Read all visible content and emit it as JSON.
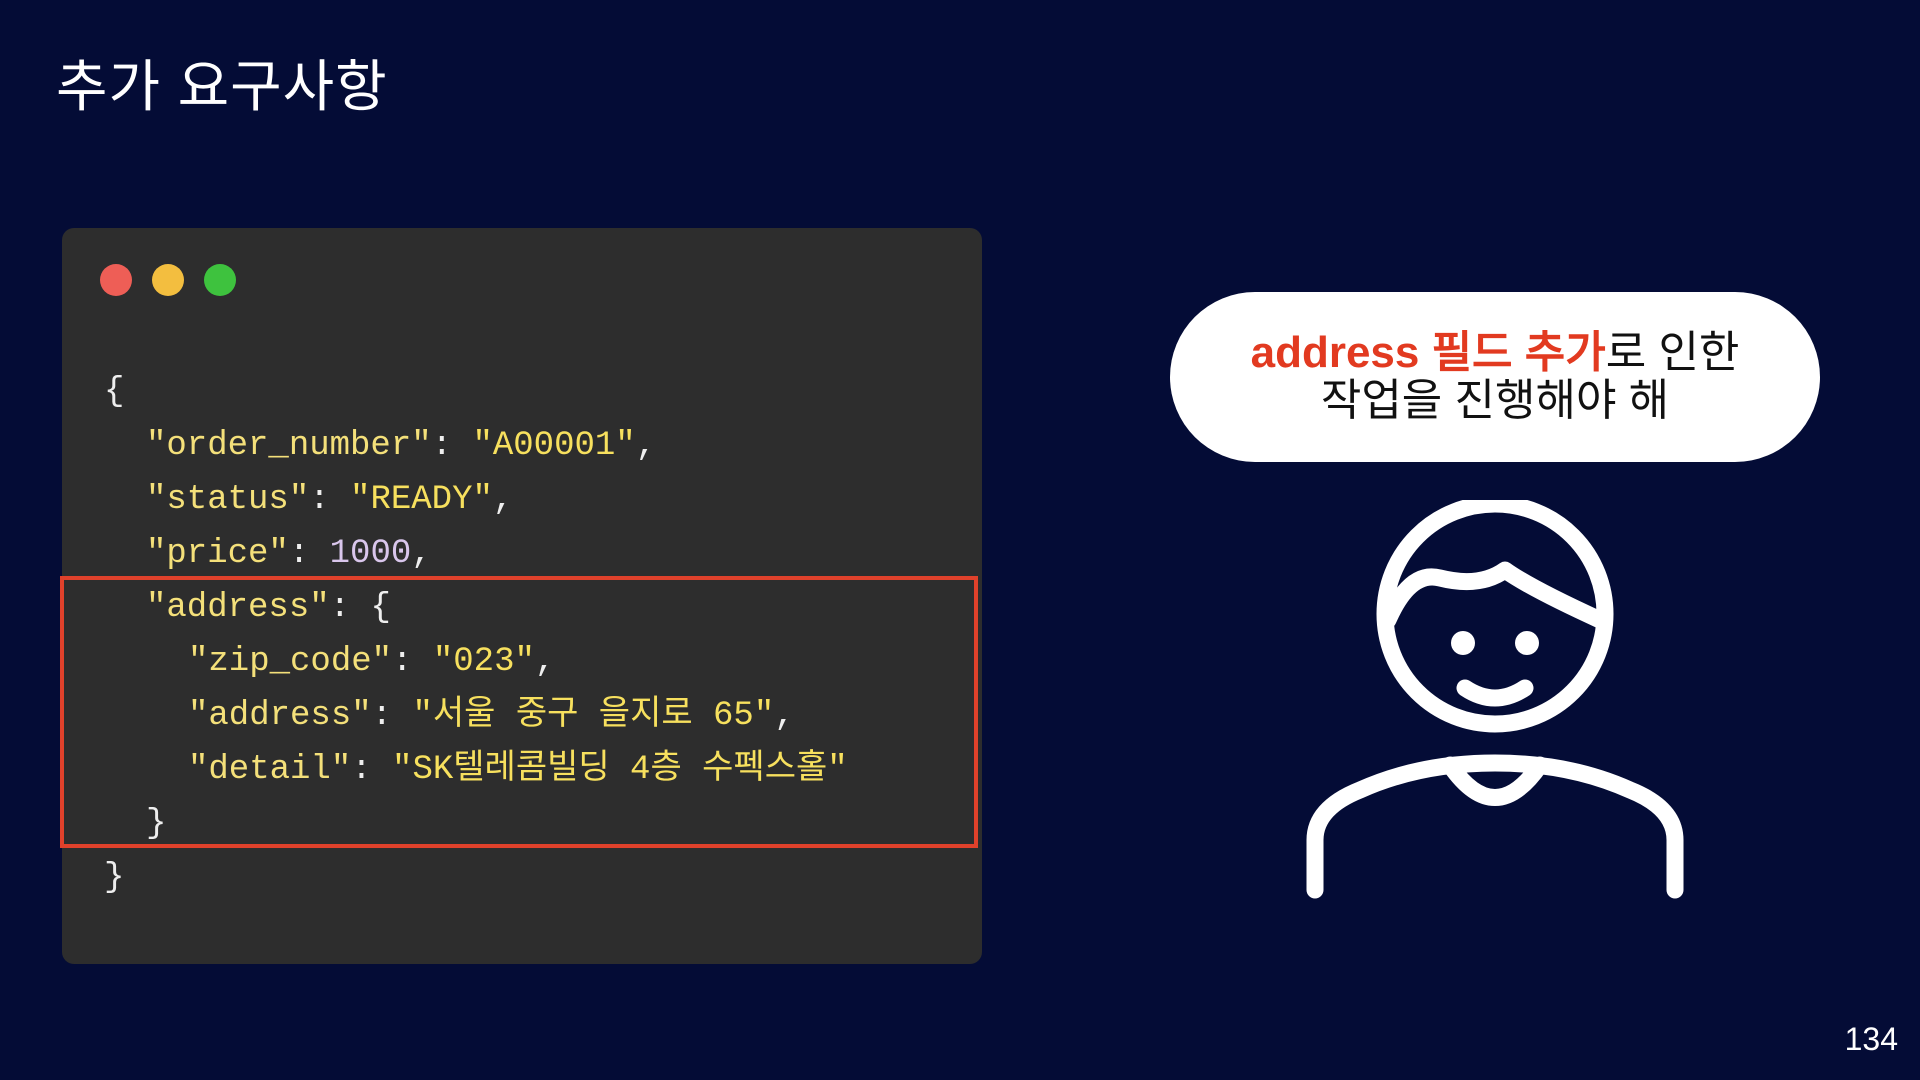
{
  "slide": {
    "title": "추가 요구사항",
    "page_number": "134"
  },
  "code_window": {
    "window_controls": [
      "close",
      "minimize",
      "maximize"
    ],
    "lines": [
      [
        {
          "t": "{",
          "c": "punc"
        }
      ],
      [
        {
          "t": "\"order_number\"",
          "c": "key"
        },
        {
          "t": ": ",
          "c": "punc"
        },
        {
          "t": "\"A00001\"",
          "c": "str"
        },
        {
          "t": ",",
          "c": "punc"
        }
      ],
      [
        {
          "t": "\"status\"",
          "c": "key"
        },
        {
          "t": ": ",
          "c": "punc"
        },
        {
          "t": "\"READY\"",
          "c": "str"
        },
        {
          "t": ",",
          "c": "punc"
        }
      ],
      [
        {
          "t": "\"price\"",
          "c": "key"
        },
        {
          "t": ": ",
          "c": "punc"
        },
        {
          "t": "1000",
          "c": "num"
        },
        {
          "t": ",",
          "c": "punc"
        }
      ],
      [
        {
          "t": "\"address\"",
          "c": "key"
        },
        {
          "t": ": {",
          "c": "punc"
        }
      ],
      [
        {
          "t": "\"zip_code\"",
          "c": "key"
        },
        {
          "t": ": ",
          "c": "punc"
        },
        {
          "t": "\"023\"",
          "c": "str"
        },
        {
          "t": ",",
          "c": "punc"
        }
      ],
      [
        {
          "t": "\"address\"",
          "c": "key"
        },
        {
          "t": ": ",
          "c": "punc"
        },
        {
          "t": "\"서울 중구 을지로 65\"",
          "c": "str"
        },
        {
          "t": ",",
          "c": "punc"
        }
      ],
      [
        {
          "t": "\"detail\"",
          "c": "key"
        },
        {
          "t": ": ",
          "c": "punc"
        },
        {
          "t": "\"SK텔레콤빌딩 4층 수펙스홀\"",
          "c": "str"
        }
      ],
      [
        {
          "t": "}",
          "c": "punc"
        }
      ],
      [
        {
          "t": "}",
          "c": "punc"
        }
      ]
    ]
  },
  "speech_bubble": {
    "line1_accent": "address 필드 추가",
    "line1_rest": "로 인한",
    "line2": "작업을 진행해야 해"
  },
  "person": {
    "icon": "person-icon"
  },
  "colors": {
    "background": "#040c36",
    "code_background": "#2d2d2d",
    "highlight_border": "#e0412b",
    "accent_text": "#e23a20",
    "json_key": "#f4e07a",
    "json_string": "#f7e05e",
    "json_number": "#d9c6ec"
  }
}
